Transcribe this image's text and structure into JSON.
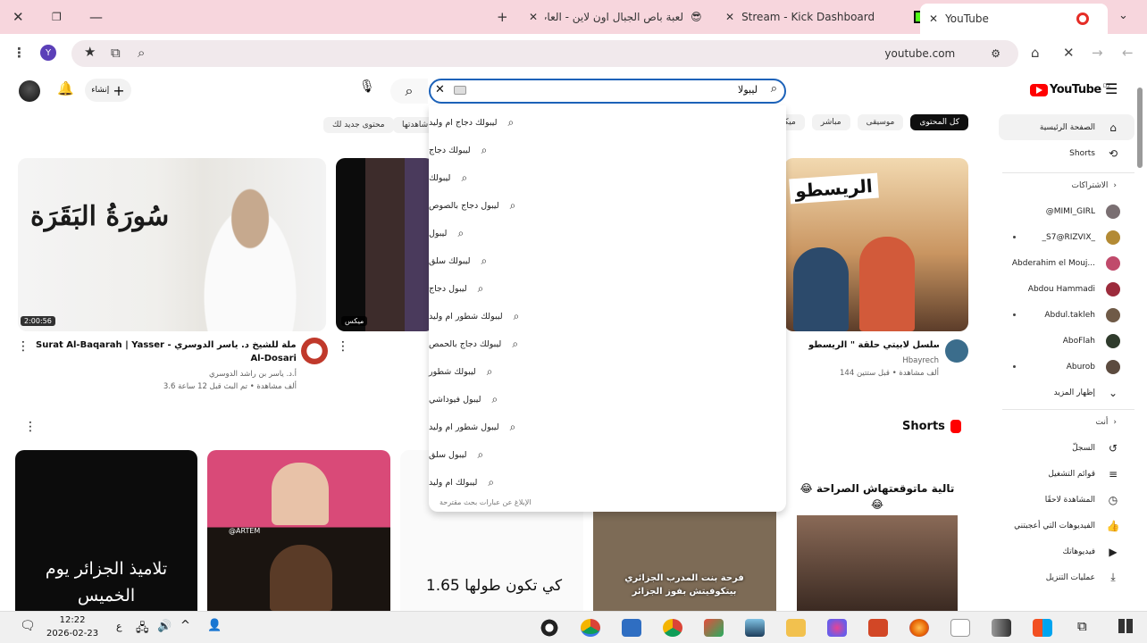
{
  "browser": {
    "tabs": [
      {
        "title": "YouTube",
        "active": true
      },
      {
        "title": "Stream - Kick Dashboard",
        "active": false
      },
      {
        "title": "لعبة باص الجبال اون لاين - العاب",
        "active": false
      }
    ],
    "url": "youtube.com",
    "profile_initial": "Y"
  },
  "youtube": {
    "logo": "YouTube",
    "logo_region": "DZ",
    "search_value": "ليبولا",
    "create_label": "إنشاء",
    "chips": [
      "كل المحتوى",
      "موسيقى",
      "مباشر",
      "ميكسات",
      "شاهدتها",
      "محتوى جديد لك"
    ],
    "suggestions": [
      "ليبولك دجاج ام وليد",
      "ليبولك دجاج",
      "ليبولك",
      "ليبول دجاج بالصوص",
      "ليبول",
      "ليبولك سلق",
      "ليبول دجاج",
      "ليبولك شطور ام وليد",
      "ليبولك دجاج بالحمص",
      "ليبولك شطور",
      "ليبول فيوداشي",
      "ليبول شطور ام وليد",
      "ليبول سلق",
      "ليبولك ام وليد"
    ],
    "suggestions_footer": "الإبلاغ عن عبارات بحث مقترحة",
    "sidebar": {
      "home": "الصفحة الرئيسية",
      "shorts": "Shorts",
      "subscriptions_header": "الاشتراكات",
      "subscriptions": [
        {
          "name": "@MIMI_GIRL",
          "color": "#7a6f72"
        },
        {
          "name": "_S7@RIZVIX_",
          "color": "#b38a34"
        },
        {
          "name": "Abderahim el Mouj...",
          "color": "#c04a6b"
        },
        {
          "name": "Abdou Hammadi",
          "color": "#9c2b3c"
        },
        {
          "name": "Abdul.takleh",
          "color": "#6f5a47"
        },
        {
          "name": "AboFlah",
          "color": "#2f3b2c"
        },
        {
          "name": "Aburob",
          "color": "#5c4b3f"
        }
      ],
      "show_more": "إظهار المزيد",
      "you_header": "أنت",
      "you_items": [
        {
          "label": "السجلّ",
          "icon": "history-icon"
        },
        {
          "label": "قوائم التشغيل",
          "icon": "playlists-icon"
        },
        {
          "label": "المشاهدة لاحقًا",
          "icon": "watch-later-icon"
        },
        {
          "label": "الفيديوهات التي أعجبتني",
          "icon": "liked-icon"
        },
        {
          "label": "فيديوهاتك",
          "icon": "your-videos-icon"
        },
        {
          "label": "عمليات التنزيل",
          "icon": "download-icon"
        }
      ]
    },
    "videos": [
      {
        "thumb_text": "سُورَةُ البَقَرَة",
        "duration": "2:00:56",
        "title_line1": "Surat Al-Baqarah | Yasser - سورة البقرة كاملة للشيخ د. ياسر الدوسري",
        "title_line2": "Al-Dosari",
        "channel": "أ.د. ياسر بن راشد الدوسري",
        "meta": "3.6 ألف مشاهدة • تم البث قبل 12 ساعة"
      },
      {
        "badge": "ميكس"
      },
      {
        "thumb_text": "الريسطو",
        "title_line1": "مسلسل لابيتي حلقة \" الريسطو \"",
        "channel": "Hbayrech",
        "meta": "144 ألف مشاهدة • قبل ستتين"
      }
    ],
    "shorts_label": "Shorts",
    "shorts": [
      {
        "caption": "تلاميذ الجزائر يوم الخميس"
      },
      {
        "caption": "@ARTEM"
      },
      {
        "caption": "كي تكون طولها 1.65"
      },
      {
        "caption": "فرحة بنت المدرب الجزائري بيتكوفيتش بفوز الجزائر"
      },
      {
        "caption": "تالية ماتوقعتهاش الصراحة 😂😂"
      }
    ]
  },
  "taskbar": {
    "time": "12:22",
    "date": "2026-02-23",
    "lang": "ع"
  }
}
